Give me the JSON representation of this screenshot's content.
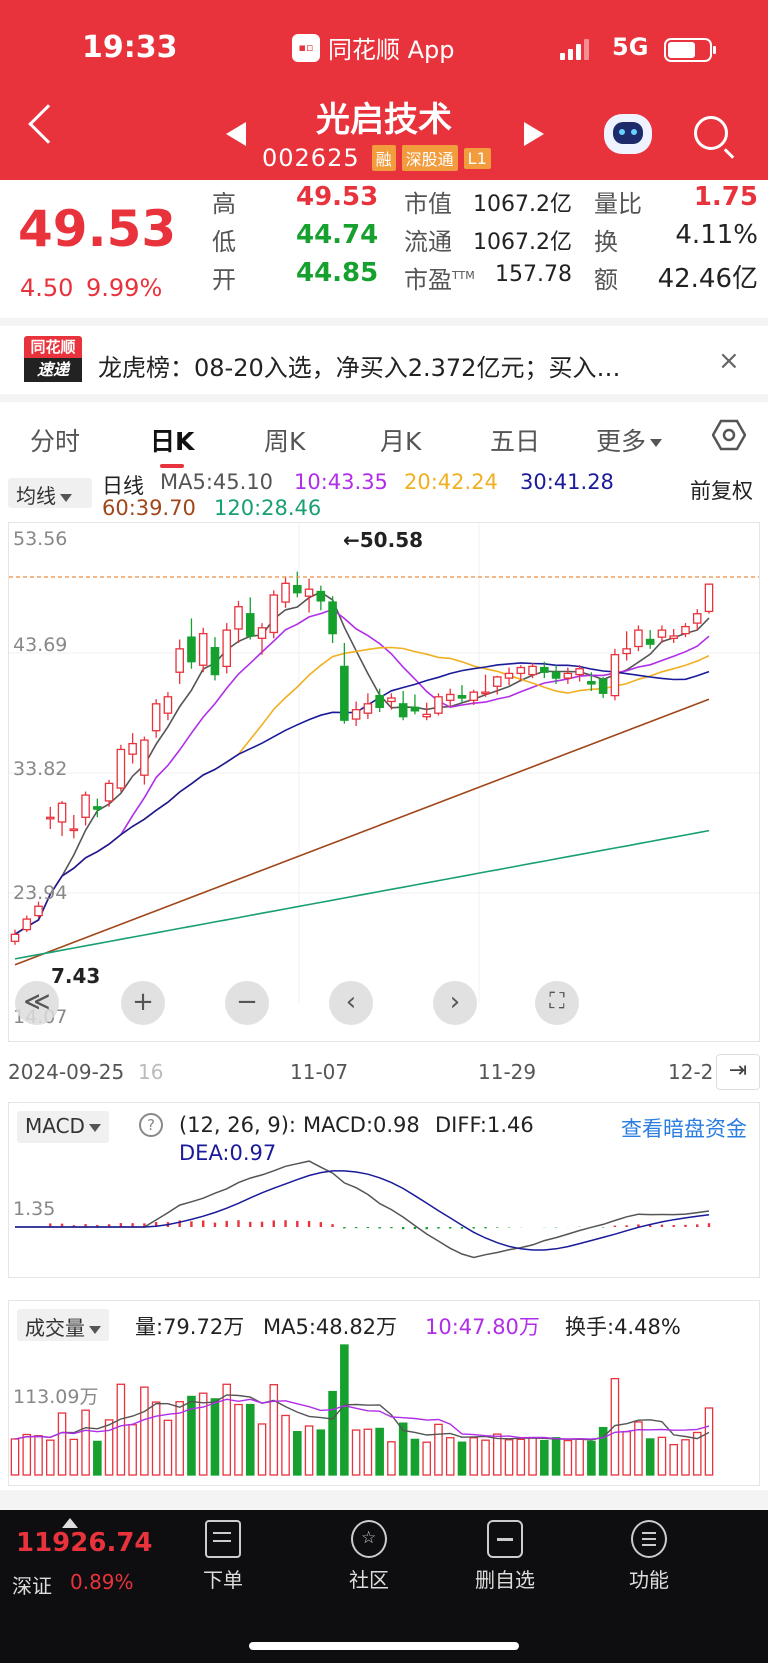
{
  "status": {
    "time": "19:33",
    "app_name": "同花顺 App",
    "network": "5G"
  },
  "stock": {
    "name": "光启技术",
    "code": "002625",
    "tags": [
      "融",
      "深股通",
      "L1"
    ]
  },
  "quote": {
    "price": "49.53",
    "change": "4.50",
    "change_pct": "9.99%",
    "high_label": "高",
    "high": "49.53",
    "low_label": "低",
    "low": "44.74",
    "open_label": "开",
    "open": "44.85",
    "mcap_label": "市值",
    "mcap": "1067.2亿",
    "float_label": "流通",
    "float": "1067.2亿",
    "pe_label": "市盈",
    "pe_sup": "TTM",
    "pe": "157.78",
    "vr_label": "量比",
    "vr": "1.75",
    "turnover_label": "换",
    "turnover": "4.11%",
    "amount_label": "额",
    "amount": "42.46亿"
  },
  "news": {
    "logo_top": "同花顺",
    "logo_bottom": "速递",
    "text": "龙虎榜：08-20入选，净买入2.372亿元；买入…",
    "close": "×"
  },
  "tabs": [
    "分时",
    "日K",
    "周K",
    "月K",
    "五日",
    "更多"
  ],
  "ma_legend": {
    "selector": "均线",
    "period_label": "日线",
    "ma5": "MA5:45.10",
    "ma10": "10:43.35",
    "ma20": "20:42.24",
    "ma30": "30:41.28",
    "ma60": "60:39.70",
    "ma120": "120:28.46",
    "adjust": "前复权"
  },
  "colors": {
    "up": "#e8323c",
    "down": "#16a02e",
    "ma5": "#555555",
    "ma10": "#b02ee8",
    "ma20": "#f0b020",
    "ma30": "#1a1a9a",
    "ma60": "#a0461a",
    "ma120": "#18a070"
  },
  "kchart": {
    "y_labels": [
      "53.56",
      "43.69",
      "33.82",
      "23.94",
      "14.07"
    ],
    "max_marker": "←50.58",
    "min_marker": "7.43",
    "zoom_buttons": {
      "back": "≪",
      "plus": "+",
      "minus": "−",
      "left": "‹",
      "right": "›",
      "full": "⛶"
    }
  },
  "chart_data": {
    "type": "candlestick",
    "ylim": [
      14.07,
      53.56
    ],
    "candles": [
      [
        19.0,
        20.0,
        18.7,
        19.6
      ],
      [
        20.0,
        21.2,
        19.8,
        20.9
      ],
      [
        21.2,
        22.4,
        21.0,
        22.0
      ],
      [
        29.5,
        30.5,
        28.6,
        29.6
      ],
      [
        29.2,
        31.0,
        28.0,
        30.8
      ],
      [
        28.5,
        29.8,
        27.8,
        28.6
      ],
      [
        29.6,
        31.8,
        28.9,
        31.5
      ],
      [
        30.5,
        31.2,
        29.6,
        30.3
      ],
      [
        31.0,
        32.8,
        30.5,
        32.5
      ],
      [
        32.1,
        35.8,
        31.8,
        35.4
      ],
      [
        35.0,
        36.8,
        34.2,
        35.9
      ],
      [
        33.2,
        36.5,
        32.4,
        36.2
      ],
      [
        37.0,
        39.7,
        36.4,
        39.3
      ],
      [
        38.5,
        40.3,
        37.9,
        39.9
      ],
      [
        42.0,
        44.8,
        41.0,
        44.0
      ],
      [
        45.0,
        46.6,
        42.3,
        42.9
      ],
      [
        42.6,
        45.8,
        42.0,
        45.3
      ],
      [
        44.1,
        45.0,
        41.3,
        41.8
      ],
      [
        42.5,
        46.2,
        41.9,
        45.6
      ],
      [
        45.7,
        48.1,
        44.5,
        47.6
      ],
      [
        47.0,
        48.4,
        44.8,
        45.1
      ],
      [
        44.9,
        46.2,
        43.5,
        45.8
      ],
      [
        45.4,
        49.0,
        44.9,
        48.6
      ],
      [
        48.0,
        50.2,
        47.5,
        49.6
      ],
      [
        49.4,
        50.6,
        48.4,
        48.8
      ],
      [
        48.5,
        50.0,
        47.1,
        49.1
      ],
      [
        48.9,
        49.4,
        47.3,
        48.1
      ],
      [
        48.0,
        48.5,
        44.5,
        45.3
      ],
      [
        42.5,
        44.5,
        37.6,
        37.9
      ],
      [
        38.0,
        39.5,
        37.4,
        38.8
      ],
      [
        38.5,
        40.2,
        38.0,
        39.3
      ],
      [
        40.0,
        40.6,
        38.6,
        39.0
      ],
      [
        39.5,
        40.2,
        38.8,
        39.8
      ],
      [
        39.3,
        40.4,
        37.9,
        38.2
      ],
      [
        39.0,
        40.1,
        38.4,
        38.7
      ],
      [
        38.2,
        39.4,
        37.9,
        38.4
      ],
      [
        38.5,
        40.2,
        38.3,
        39.9
      ],
      [
        39.6,
        40.6,
        39.0,
        40.1
      ],
      [
        40.0,
        40.9,
        39.4,
        39.8
      ],
      [
        39.6,
        40.5,
        39.2,
        40.3
      ],
      [
        40.2,
        41.8,
        39.9,
        40.3
      ],
      [
        40.8,
        41.7,
        40.1,
        41.6
      ],
      [
        41.5,
        42.4,
        40.9,
        41.9
      ],
      [
        41.9,
        42.6,
        41.2,
        42.4
      ],
      [
        41.8,
        42.8,
        41.5,
        42.5
      ],
      [
        42.4,
        42.9,
        41.5,
        42.0
      ],
      [
        42.0,
        42.6,
        41.0,
        41.5
      ],
      [
        41.5,
        42.4,
        41.0,
        41.9
      ],
      [
        41.8,
        42.6,
        41.2,
        42.3
      ],
      [
        41.2,
        42.0,
        40.4,
        41.0
      ],
      [
        41.4,
        41.6,
        39.8,
        40.2
      ],
      [
        40.0,
        44.0,
        39.6,
        43.5
      ],
      [
        43.6,
        45.5,
        43.0,
        44.0
      ],
      [
        44.2,
        46.0,
        43.8,
        45.6
      ],
      [
        44.8,
        45.6,
        44.0,
        44.4
      ],
      [
        45.0,
        46.0,
        44.5,
        45.6
      ],
      [
        44.9,
        45.7,
        44.5,
        45.1
      ],
      [
        45.3,
        46.2,
        45.0,
        45.9
      ],
      [
        46.2,
        47.4,
        45.6,
        47.0
      ],
      [
        47.2,
        49.53,
        47.0,
        49.53
      ]
    ]
  },
  "axis": {
    "dates": [
      "2024-09-25",
      "16",
      "11-07",
      "11-29",
      "12-2"
    ],
    "jump": "⇥"
  },
  "macd": {
    "selector": "MACD",
    "params": "(12, 26, 9):",
    "macd": "MACD:0.98",
    "diff": "DIFF:1.46",
    "dea": "DEA:0.97",
    "y_label": "1.35",
    "link": "查看暗盘资金"
  },
  "volume": {
    "selector": "成交量",
    "vol": "量:79.72万",
    "ma5": "MA5:48.82万",
    "ma10": "10:47.80万",
    "turnover": "换手:4.48%",
    "y_label": "113.09万"
  },
  "bottom": {
    "index_value": "11926.74",
    "index_name": "深证",
    "index_pct": "0.89%",
    "nav": [
      {
        "label": "下单",
        "icon": "order-icon"
      },
      {
        "label": "社区",
        "icon": "community-icon"
      },
      {
        "label": "删自选",
        "icon": "remove-watchlist-icon"
      },
      {
        "label": "功能",
        "icon": "menu-icon"
      }
    ]
  }
}
